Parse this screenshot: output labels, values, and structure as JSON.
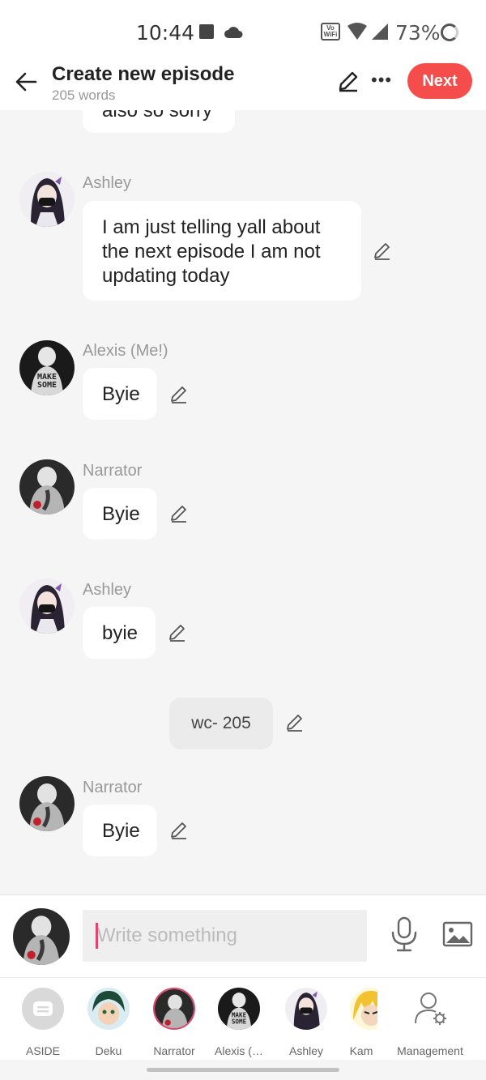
{
  "status_bar": {
    "time": "10:44",
    "vowifi": "Vo WiFi",
    "battery": "73%"
  },
  "header": {
    "title": "Create new episode",
    "subtitle": "205 words",
    "next_label": "Next"
  },
  "messages": [
    {
      "sender": "",
      "text": "also so sorry",
      "avatar": "ashley-avatar"
    },
    {
      "sender": "Ashley",
      "text": "I am just telling yall about the next episode I am not updating today",
      "avatar": "ashley-avatar"
    },
    {
      "sender": "Alexis (Me!)",
      "text": "Byie",
      "avatar": "alexis-avatar"
    },
    {
      "sender": "Narrator",
      "text": "Byie",
      "avatar": "narrator-avatar"
    },
    {
      "sender": "Ashley",
      "text": "byie",
      "avatar": "ashley-avatar"
    },
    {
      "sender": "Narrator",
      "text": "Byie",
      "avatar": "narrator-avatar"
    }
  ],
  "aside": {
    "text": "wc- 205"
  },
  "composer": {
    "placeholder": "Write something"
  },
  "characters": [
    {
      "label": "ASIDE",
      "icon": "aside-icon"
    },
    {
      "label": "Deku",
      "icon": "deku-avatar"
    },
    {
      "label": "Narrator",
      "icon": "narrator-avatar"
    },
    {
      "label": "Alexis (…",
      "icon": "alexis-avatar"
    },
    {
      "label": "Ashley",
      "icon": "ashley-avatar"
    },
    {
      "label": "Kam",
      "icon": "kam-avatar"
    },
    {
      "label": "Management",
      "icon": "management-icon"
    }
  ],
  "colors": {
    "accent": "#f54c4c",
    "cursor": "#e0456e",
    "background": "#f5f5f5"
  }
}
